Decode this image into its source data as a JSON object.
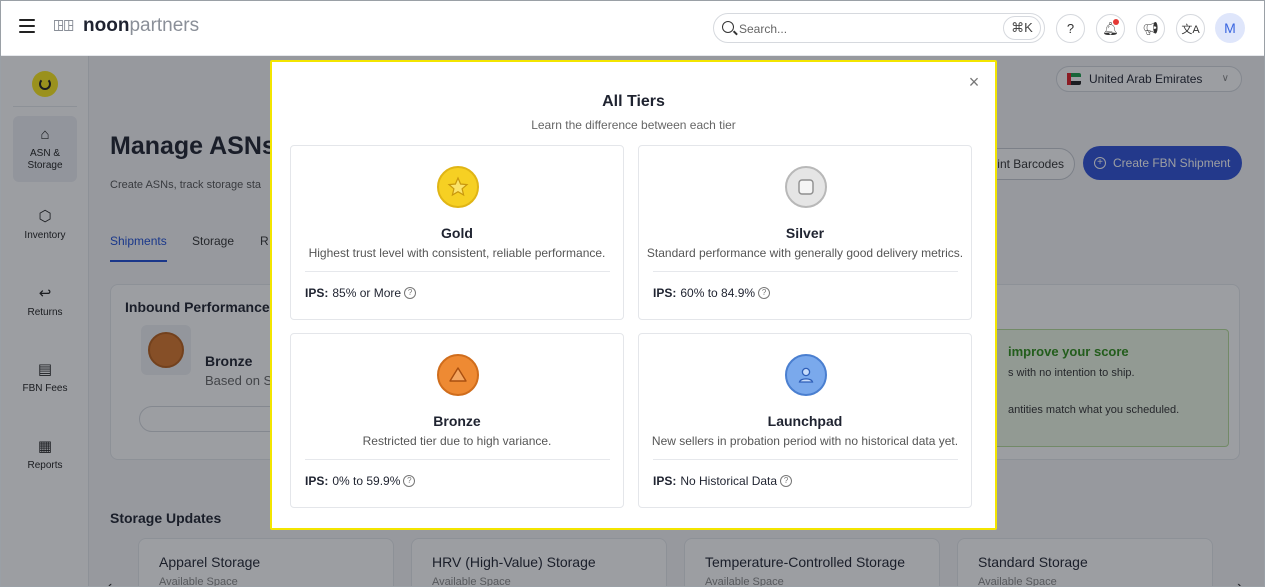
{
  "header": {
    "logo_bold": "noon",
    "logo_light": "partners",
    "search_placeholder": "Search...",
    "search_shortcut": "⌘K",
    "avatar_initial": "M"
  },
  "sidebar": {
    "items": [
      {
        "label": "ASN & Storage",
        "icon": "home-icon",
        "active": true
      },
      {
        "label": "Inventory",
        "icon": "box-icon",
        "active": false
      },
      {
        "label": "Returns",
        "icon": "return-arrow-icon",
        "active": false
      },
      {
        "label": "FBN Fees",
        "icon": "receipt-icon",
        "active": false
      },
      {
        "label": "Reports",
        "icon": "report-chart-icon",
        "active": false
      }
    ]
  },
  "main": {
    "country": "United Arab Emirates",
    "title": "Manage ASNs",
    "subtitle": "Create ASNs, track storage sta",
    "print_barcodes": "int Barcodes",
    "create_shipment": "Create FBN Shipment",
    "tabs": [
      "Shipments",
      "Storage",
      "R"
    ],
    "performance": {
      "title": "Inbound Performance Ti",
      "tier_name": "Bronze",
      "tier_sub": "Based on S",
      "tip_title": "improve your score",
      "tip_line1": "s with no intention to ship.",
      "tip_line2": "antities match what you scheduled."
    },
    "storage_heading": "Storage Updates",
    "storage_cards": [
      {
        "name": "Apparel Storage",
        "sub": "Available Space"
      },
      {
        "name": "HRV (High-Value) Storage",
        "sub": "Available Space"
      },
      {
        "name": "Temperature-Controlled Storage",
        "sub": "Available Space"
      },
      {
        "name": "Standard Storage",
        "sub": "Available Space"
      }
    ]
  },
  "modal": {
    "title": "All Tiers",
    "subtitle": "Learn the difference between each tier",
    "ips_label": "IPS:",
    "tiers": [
      {
        "name": "Gold",
        "desc": "Highest trust level with consistent, reliable performance.",
        "ips": "85% or More",
        "medal_color": "#f6d023",
        "medal_ring": "#e0b515",
        "icon": "star-icon"
      },
      {
        "name": "Silver",
        "desc": "Standard performance with generally good delivery metrics.",
        "ips": "60% to 84.9%",
        "medal_color": "#e5e5e5",
        "medal_ring": "#b8b8b8",
        "icon": "square-icon"
      },
      {
        "name": "Bronze",
        "desc": "Restricted tier due to high variance.",
        "ips": "0% to 59.9%",
        "medal_color": "#ee8a33",
        "medal_ring": "#d06d1c",
        "icon": "triangle-icon"
      },
      {
        "name": "Launchpad",
        "desc": "New sellers in probation period with no historical data yet.",
        "ips": "No Historical Data",
        "medal_color": "#7aa9ec",
        "medal_ring": "#4a7fd0",
        "icon": "user-icon"
      }
    ]
  }
}
